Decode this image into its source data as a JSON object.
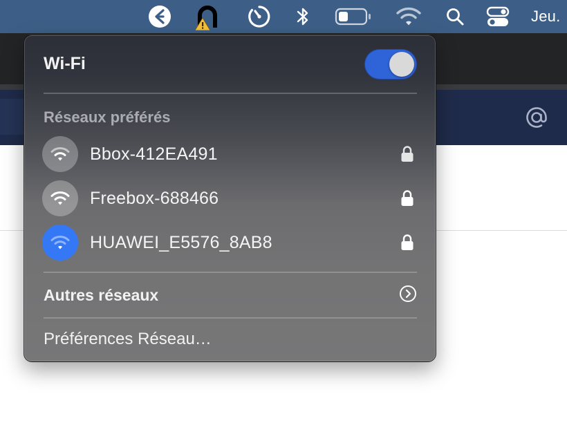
{
  "menubar": {
    "clock": "Jeu.",
    "icons": [
      "app-icon",
      "warning-app-icon",
      "timer-icon",
      "bluetooth-icon",
      "battery-icon",
      "wifi-icon",
      "search-icon",
      "control-center-icon"
    ]
  },
  "app": {
    "header_icon": "at-icon"
  },
  "wifi_menu": {
    "title": "Wi-Fi",
    "enabled": true,
    "preferred_label": "Réseaux préférés",
    "networks": [
      {
        "name": "Bbox-412EA491",
        "secured": true,
        "connected": false
      },
      {
        "name": "Freebox-688466",
        "secured": true,
        "connected": false
      },
      {
        "name": "HUAWEI_E5576_8AB8",
        "secured": true,
        "connected": true
      }
    ],
    "other_networks_label": "Autres réseaux",
    "network_prefs_label": "Préférences Réseau…"
  },
  "colors": {
    "accent": "#2f63d8",
    "connected_icon_bg": "#3478f6",
    "menubar": "#3d5f87"
  }
}
